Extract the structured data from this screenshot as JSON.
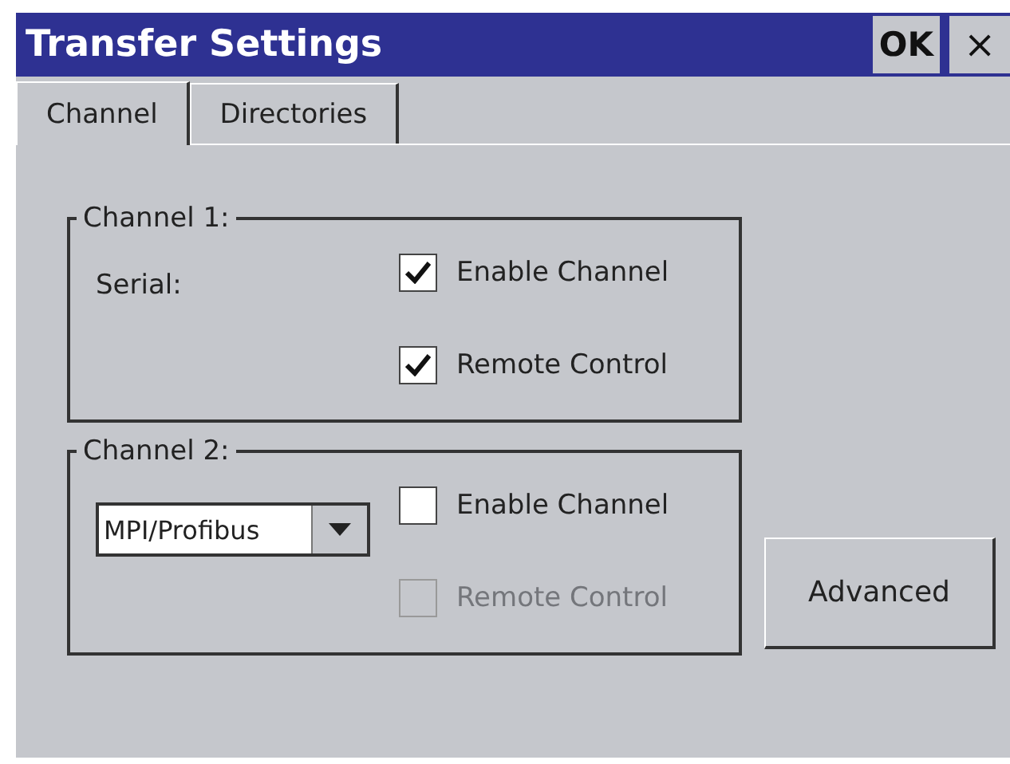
{
  "window": {
    "title": "Transfer Settings",
    "buttons": [
      "OK",
      "×"
    ]
  },
  "tabs": [
    {
      "label": "Channel",
      "selected": true
    },
    {
      "label": "Directories",
      "selected": false
    }
  ],
  "groups": [
    {
      "title": "Channel 1:",
      "label": "Serial:",
      "options": [
        {
          "label": "Enable Channel",
          "checked": true,
          "disabled": false
        },
        {
          "label": "Remote Control",
          "checked": true,
          "disabled": false
        }
      ]
    },
    {
      "title": "Channel 2:",
      "dropdown": {
        "value": "MPI/Profibus"
      },
      "options": [
        {
          "label": "Enable Channel",
          "checked": false,
          "disabled": false
        },
        {
          "label": "Remote Control",
          "checked": false,
          "disabled": true
        }
      ]
    }
  ],
  "buttons": [
    "Advanced"
  ]
}
